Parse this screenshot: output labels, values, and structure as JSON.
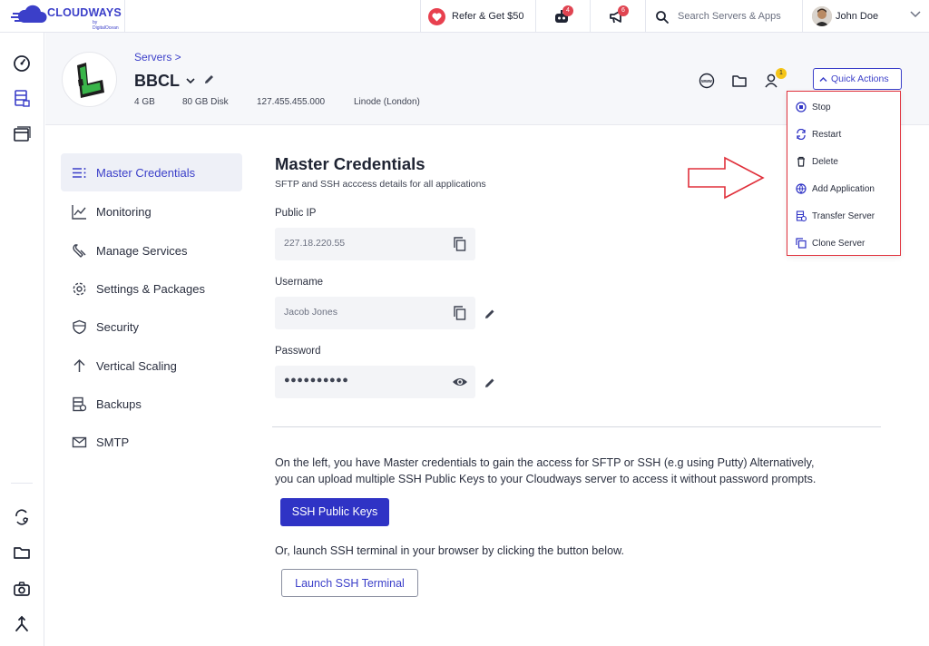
{
  "topbar": {
    "logo_text": "CLOUDWAYS",
    "logo_sub": "by DigitalOcean",
    "refer_label": "Refer & Get $50",
    "bot_badge": "4",
    "announce_badge": "6",
    "search_placeholder": "Search Servers & Apps",
    "user_name": "John Doe"
  },
  "server": {
    "breadcrumb": "Servers >",
    "name": "BBCL",
    "ram": "4 GB",
    "disk": "80 GB Disk",
    "ip": "127.455.455.000",
    "provider": "Linode (London)",
    "team_badge": "1"
  },
  "quick_actions": {
    "label": "Quick Actions",
    "items": [
      {
        "label": "Stop",
        "icon": "stop-icon"
      },
      {
        "label": "Restart",
        "icon": "restart-icon"
      },
      {
        "label": "Delete",
        "icon": "trash-icon"
      },
      {
        "label": "Add Application",
        "icon": "www-icon"
      },
      {
        "label": "Transfer Server",
        "icon": "transfer-icon"
      },
      {
        "label": "Clone Server",
        "icon": "clone-icon"
      }
    ]
  },
  "left_menu": [
    {
      "label": "Master Credentials",
      "icon": "list-icon",
      "active": true
    },
    {
      "label": "Monitoring",
      "icon": "chart-icon"
    },
    {
      "label": "Manage Services",
      "icon": "wrench-icon"
    },
    {
      "label": "Settings & Packages",
      "icon": "gear-icon"
    },
    {
      "label": "Security",
      "icon": "shield-icon"
    },
    {
      "label": "Vertical Scaling",
      "icon": "arrow-up-icon"
    },
    {
      "label": "Backups",
      "icon": "backup-icon"
    },
    {
      "label": "SMTP",
      "icon": "mail-icon"
    }
  ],
  "main": {
    "title": "Master Credentials",
    "subtitle": "SFTP and SSH acccess details for all applications",
    "public_ip_label": "Public IP",
    "public_ip_value": "227.18.220.55",
    "username_label": "Username",
    "username_value": "Jacob Jones",
    "password_label": "Password",
    "password_value": "●●●●●●●●●●",
    "para1_line1": "On the left, you have Master credentials to gain the access for SFTP or SSH (e.g using Putty) Alternatively,",
    "para1_line2": "you can upload multiple SSH Public Keys to your Cloudways server to access it without password prompts.",
    "ssh_keys_button": "SSH Public Keys",
    "para2": "Or, launch SSH terminal in your browser by clicking the button below.",
    "launch_button": "Launch SSH Terminal"
  },
  "colors": {
    "brand": "#3b3fc9",
    "primary_button": "#2f33c5",
    "highlight": "#e0303b"
  }
}
